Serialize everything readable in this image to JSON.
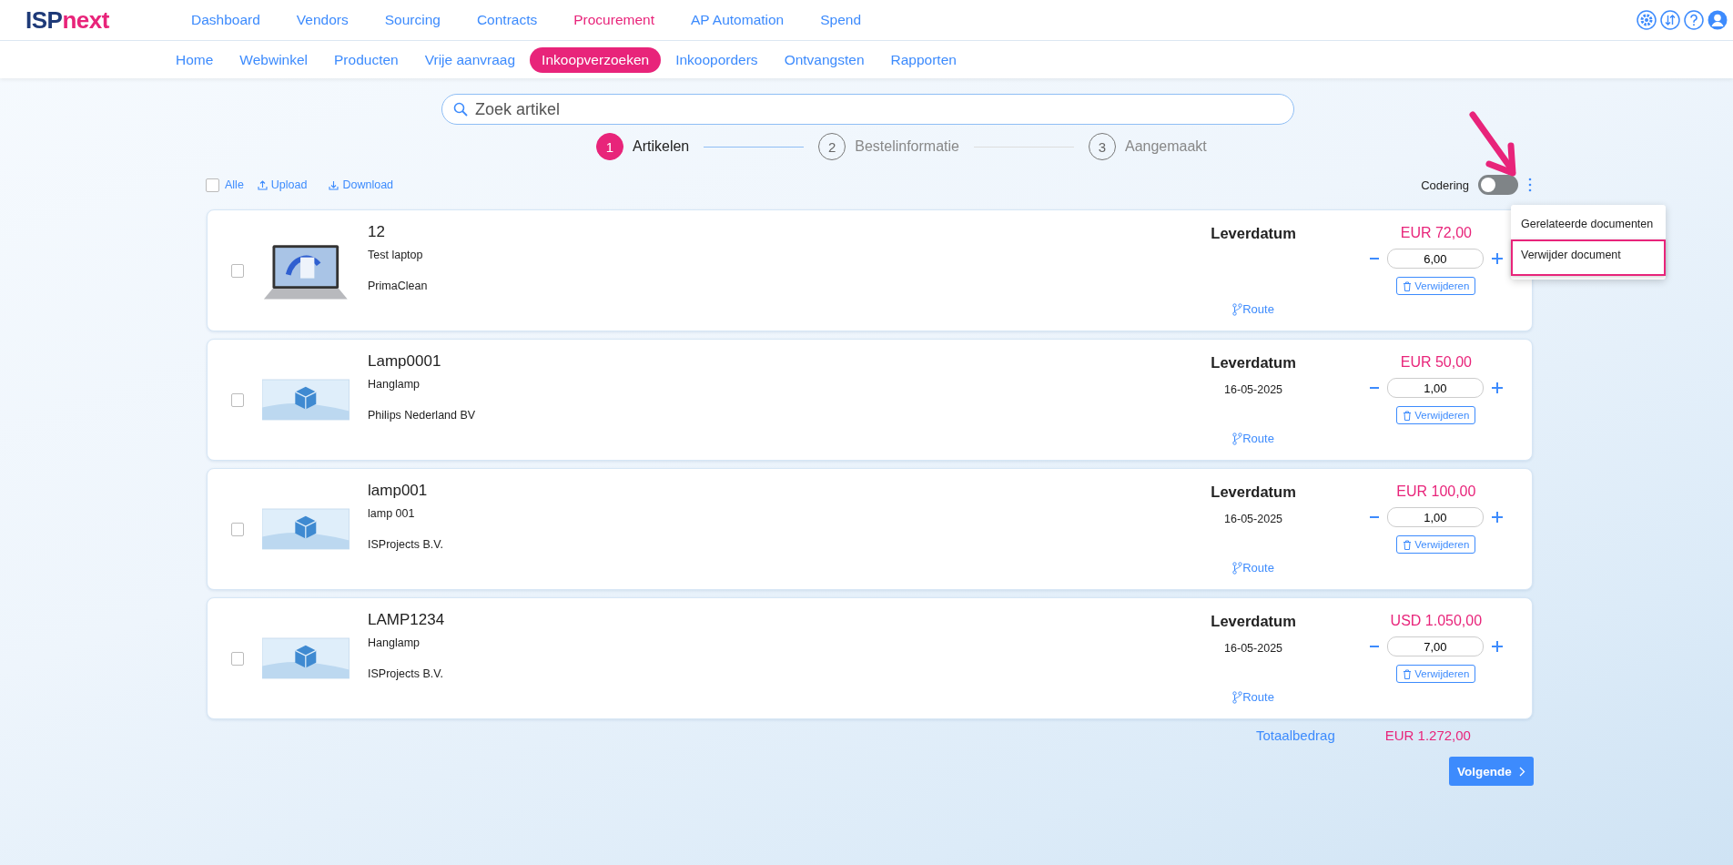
{
  "logo": {
    "part_1": "ISP",
    "part_2": "next"
  },
  "main_nav": [
    {
      "label": "Dashboard",
      "selected": false
    },
    {
      "label": "Vendors",
      "selected": false
    },
    {
      "label": "Sourcing",
      "selected": false
    },
    {
      "label": "Contracts",
      "selected": false
    },
    {
      "label": "Procurement",
      "selected": true
    },
    {
      "label": "AP Automation",
      "selected": false
    },
    {
      "label": "Spend",
      "selected": false
    }
  ],
  "sub_nav": [
    {
      "label": "Home",
      "selected": false
    },
    {
      "label": "Webwinkel",
      "selected": false
    },
    {
      "label": "Producten",
      "selected": false
    },
    {
      "label": "Vrije aanvraag",
      "selected": false
    },
    {
      "label": "Inkoopverzoeken",
      "selected": true
    },
    {
      "label": "Inkooporders",
      "selected": false
    },
    {
      "label": "Ontvangsten",
      "selected": false
    },
    {
      "label": "Rapporten",
      "selected": false
    }
  ],
  "search": {
    "placeholder": "Zoek artikel"
  },
  "steps": [
    {
      "number": "1",
      "label": "Artikelen",
      "selected": true
    },
    {
      "number": "2",
      "label": "Bestelinformatie",
      "selected": false
    },
    {
      "number": "3",
      "label": "Aangemaakt",
      "selected": false
    }
  ],
  "toolbar": {
    "select_all": {
      "label": "Alle",
      "checked": false
    },
    "upload": "Upload",
    "download": "Download",
    "coding": {
      "label": "Codering",
      "on": false
    }
  },
  "menu": [
    {
      "label": "Gerelateerde documenten",
      "highlighted": false
    },
    {
      "label": "Verwijder document",
      "highlighted": true
    }
  ],
  "items": [
    {
      "code": "12",
      "name": "Test laptop",
      "supplier": "PrimaClean",
      "kind": "photo",
      "date_label": "Leverdatum",
      "route": "Route",
      "price": "EUR 72,00",
      "quantity": "6,00",
      "remove": "Verwijderen",
      "checked": false
    },
    {
      "code": "Lamp0001",
      "name": "Hanglamp",
      "supplier": "Philips Nederland BV",
      "kind": "placeholder",
      "date_label": "Leverdatum",
      "date": "16-05-2025",
      "route": "Route",
      "price": "EUR 50,00",
      "quantity": "1,00",
      "remove": "Verwijderen",
      "checked": false
    },
    {
      "code": "lamp001",
      "name": "lamp 001",
      "supplier": "ISProjects B.V.",
      "kind": "placeholder",
      "date_label": "Leverdatum",
      "date": "16-05-2025",
      "route": "Route",
      "price": "EUR 100,00",
      "quantity": "1,00",
      "remove": "Verwijderen",
      "checked": false
    },
    {
      "code": "LAMP1234",
      "name": "Hanglamp",
      "supplier": "ISProjects B.V.",
      "kind": "placeholder",
      "date_label": "Leverdatum",
      "date": "16-05-2025",
      "route": "Route",
      "price": "USD 1.050,00",
      "quantity": "7,00",
      "remove": "Verwijderen",
      "checked": false
    }
  ],
  "total": {
    "label": "Totaalbedrag",
    "amount": "EUR 1.272,00"
  },
  "next_button": "Volgende"
}
